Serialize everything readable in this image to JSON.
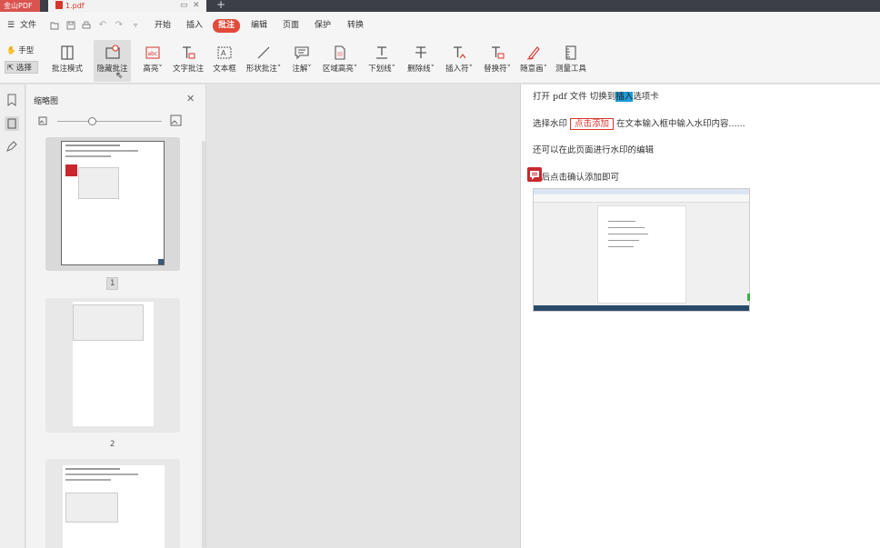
{
  "titlebar": {
    "app_name": "金山PDF",
    "doc_tab": "1.pdf",
    "new_tab": "+"
  },
  "menu": {
    "file": "文件",
    "tabs": [
      "开始",
      "插入",
      "批注",
      "编辑",
      "页面",
      "保护",
      "转换"
    ],
    "active_tab": "批注"
  },
  "ribbon": {
    "hand": "手型",
    "select": "选择",
    "tools": [
      {
        "label": "批注模式",
        "icon": "annotation-mode-icon"
      },
      {
        "label": "隐藏批注",
        "icon": "hide-annotation-icon"
      },
      {
        "label": "高亮",
        "icon": "highlight-icon",
        "dropdown": true
      },
      {
        "label": "文字批注",
        "icon": "text-annotation-icon"
      },
      {
        "label": "文本框",
        "icon": "textbox-icon"
      },
      {
        "label": "形状批注",
        "icon": "shape-annotation-icon",
        "dropdown": true
      },
      {
        "label": "注解",
        "icon": "note-icon",
        "dropdown": true
      },
      {
        "label": "区域高亮",
        "icon": "area-highlight-icon",
        "dropdown": true
      },
      {
        "label": "下划线",
        "icon": "underline-icon",
        "dropdown": true
      },
      {
        "label": "删除线",
        "icon": "strikethrough-icon",
        "dropdown": true
      },
      {
        "label": "插入符",
        "icon": "insert-caret-icon",
        "dropdown": true
      },
      {
        "label": "替换符",
        "icon": "replace-caret-icon",
        "dropdown": true
      },
      {
        "label": "随意画",
        "icon": "freehand-icon",
        "dropdown": true
      },
      {
        "label": "测量工具",
        "icon": "measure-icon"
      }
    ],
    "dropdown_mark": "˅"
  },
  "thumbnail_panel": {
    "title": "缩略图",
    "pages": [
      "1",
      "2"
    ],
    "current_page": "1"
  },
  "document": {
    "lines": [
      {
        "before": "打开 pdf 文件   切换到",
        "highlight": "插入",
        "after": "选项卡"
      },
      {
        "before": "选择水印",
        "boxed": "点击添加",
        "after": "在文本输入框中输入水印内容......"
      },
      {
        "text": "还可以在此页面进行水印的编辑"
      },
      {
        "text": "最后点击确认添加即可"
      }
    ]
  },
  "colors": {
    "accent": "#e24a3b",
    "app_tab": "#d9534f",
    "highlight": "#1f9ad6",
    "comment": "#c8282d"
  }
}
